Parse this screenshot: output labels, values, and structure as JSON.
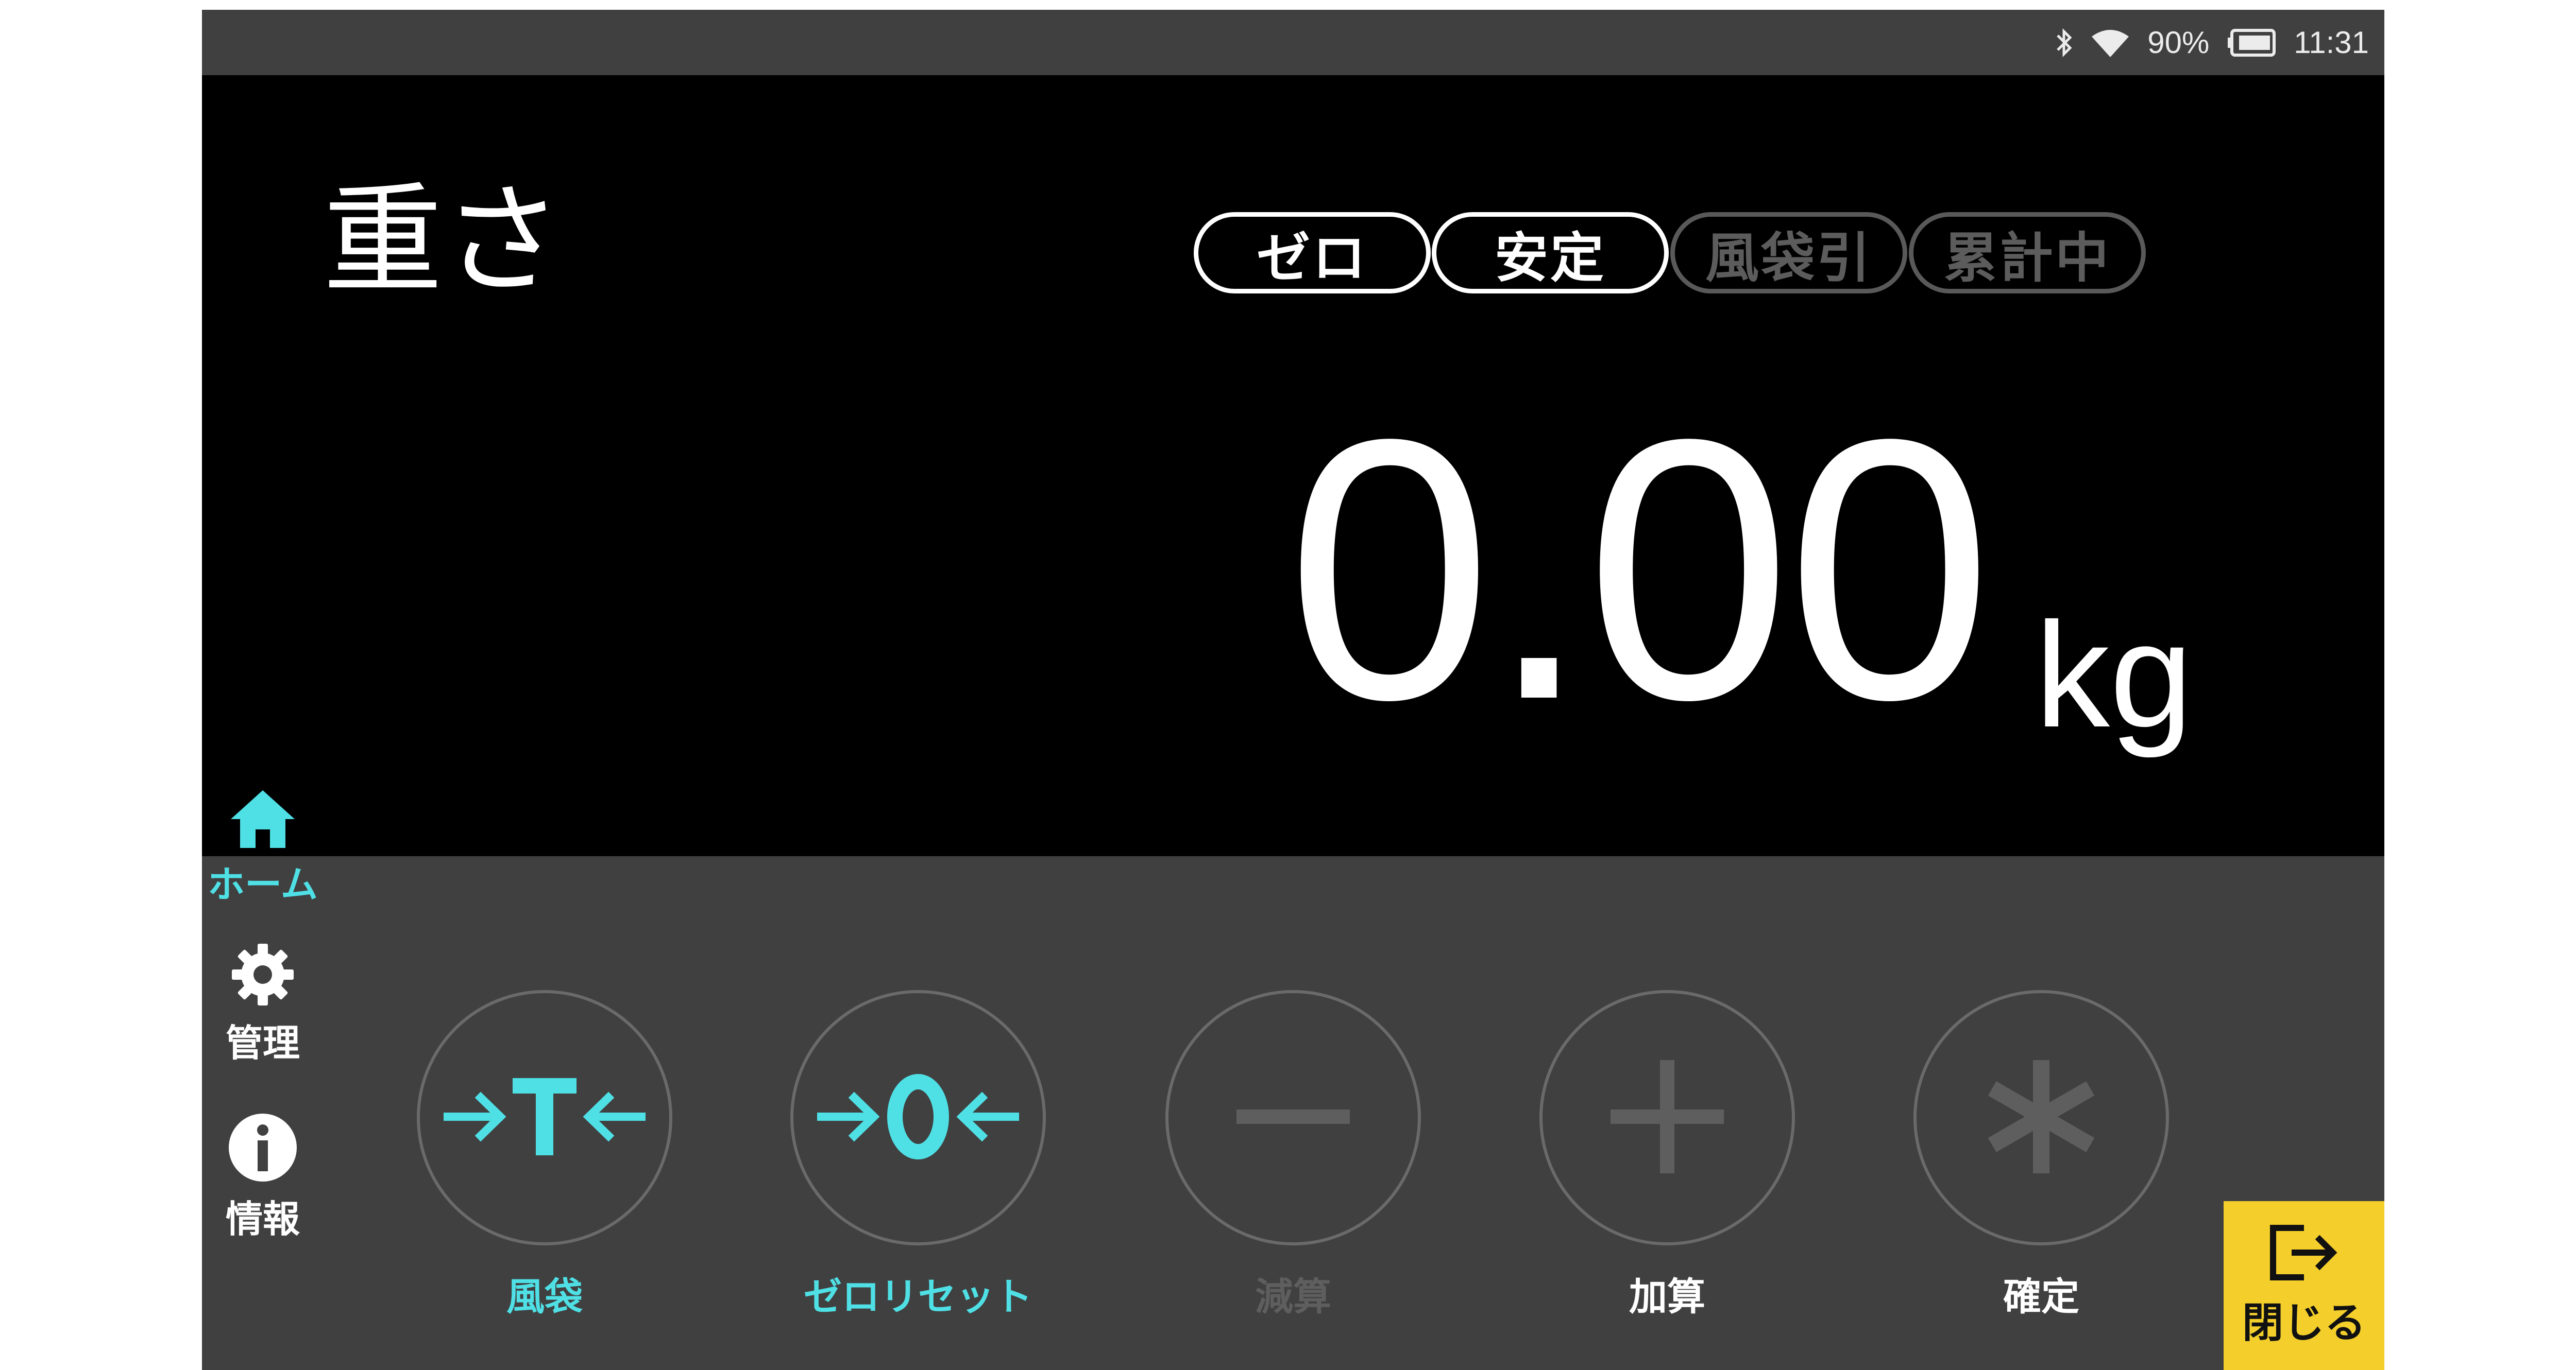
{
  "status_bar": {
    "battery_text": "90%",
    "time": "11:31",
    "icons": [
      "bluetooth-icon",
      "wifi-icon",
      "battery-icon"
    ]
  },
  "display": {
    "title": "重さ",
    "indicators": [
      {
        "label": "ゼロ",
        "active": true
      },
      {
        "label": "安定",
        "active": true
      },
      {
        "label": "風袋引",
        "active": false
      },
      {
        "label": "累計中",
        "active": false
      }
    ],
    "weight": "0.00",
    "unit": "kg"
  },
  "sidebar": {
    "items": [
      {
        "label": "ホーム",
        "icon": "home-icon",
        "selected": true
      },
      {
        "label": "管理",
        "icon": "gear-icon",
        "selected": false
      },
      {
        "label": "情報",
        "icon": "info-icon",
        "selected": false
      }
    ]
  },
  "actions": [
    {
      "label": "風袋",
      "icon": "tare-icon",
      "enabled": true
    },
    {
      "label": "ゼロリセット",
      "icon": "zero-reset-icon",
      "enabled": true
    },
    {
      "label": "減算",
      "icon": "minus-icon",
      "enabled": false
    },
    {
      "label": "加算",
      "icon": "plus-icon",
      "enabled": true
    },
    {
      "label": "確定",
      "icon": "asterisk-icon",
      "enabled": true
    }
  ],
  "close_button": {
    "label": "閉じる",
    "icon": "exit-icon"
  },
  "colors": {
    "accent": "#4fe0e6",
    "disabled": "#5e5e5e",
    "close_bg": "#f4cf2b",
    "panel": "#404040",
    "display_bg": "#000000"
  }
}
